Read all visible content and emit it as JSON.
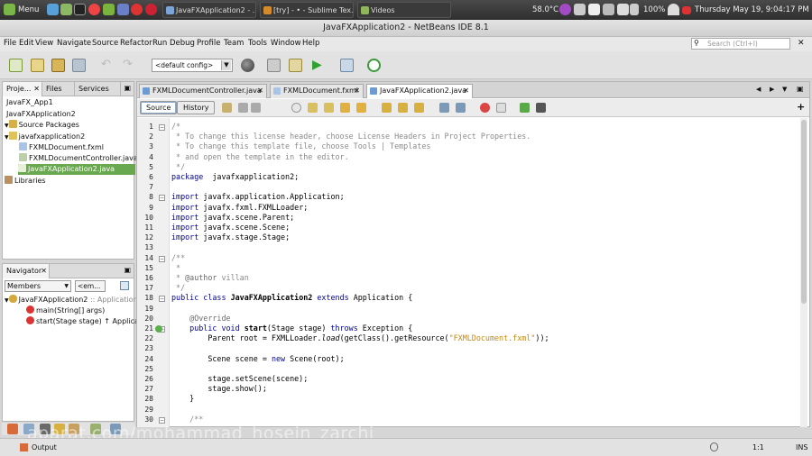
{
  "panel": {
    "menu_label": "Menu",
    "tasks": [
      "JavaFXApplication2 - ...",
      "[try] - • - Sublime Tex...",
      "Videos"
    ],
    "temperature": "58.0°C",
    "battery": "100%",
    "clock": "Thursday May 19, 9:04:17 PM"
  },
  "window": {
    "title": "JavaFXApplication2 - NetBeans IDE 8.1"
  },
  "menu": [
    "File",
    "Edit",
    "View",
    "Navigate",
    "Source",
    "Refactor",
    "Run",
    "Debug",
    "Profile",
    "Team",
    "Tools",
    "Window",
    "Help"
  ],
  "search": {
    "placeholder": "Search (Ctrl+I)"
  },
  "toolbar": {
    "config": "<default config>"
  },
  "projects": {
    "tabs": [
      "Proje...",
      "Files",
      "Services"
    ],
    "tree": [
      {
        "label": "JavaFX_App1"
      },
      {
        "label": "JavaFXApplication2"
      },
      {
        "label": "Source Packages"
      },
      {
        "label": "javafxapplication2"
      },
      {
        "label": "FXMLDocument.fxml"
      },
      {
        "label": "FXMLDocumentController.java"
      },
      {
        "label": "JavaFXApplication2.java"
      },
      {
        "label": "Libraries"
      }
    ]
  },
  "navigator": {
    "title": "Navigator",
    "filter": "Members",
    "filter2": "<em...",
    "class_name": "JavaFXApplication2",
    "class_suffix": ":: Application",
    "members": [
      {
        "label": "main(String[] args)"
      },
      {
        "label": "start(Stage stage) ↑ Application"
      }
    ]
  },
  "editor": {
    "tabs": [
      "FXMLDocumentController.java",
      "FXMLDocument.fxml",
      "JavaFXApplication2.java"
    ],
    "source_label": "Source",
    "history_label": "History",
    "line_numbers": [
      "1",
      "2",
      "3",
      "4",
      "5",
      "6",
      "7",
      "8",
      "9",
      "10",
      "11",
      "12",
      "13",
      "14",
      "15",
      "16",
      "17",
      "18",
      "19",
      "20",
      "21",
      "22",
      "23",
      "24",
      "25",
      "26",
      "27",
      "28",
      "29",
      "30"
    ]
  },
  "status": {
    "output_label": "Output",
    "position": "1:1",
    "mode": "INS"
  },
  "watermark": "aparat.com/mohammad_hosein_zarchi",
  "colors": {
    "accent": "#4a9de0",
    "keyword": "#00009a",
    "comment": "#8a8a8a",
    "string": "#c6880d",
    "selection": "#6aa84f"
  }
}
